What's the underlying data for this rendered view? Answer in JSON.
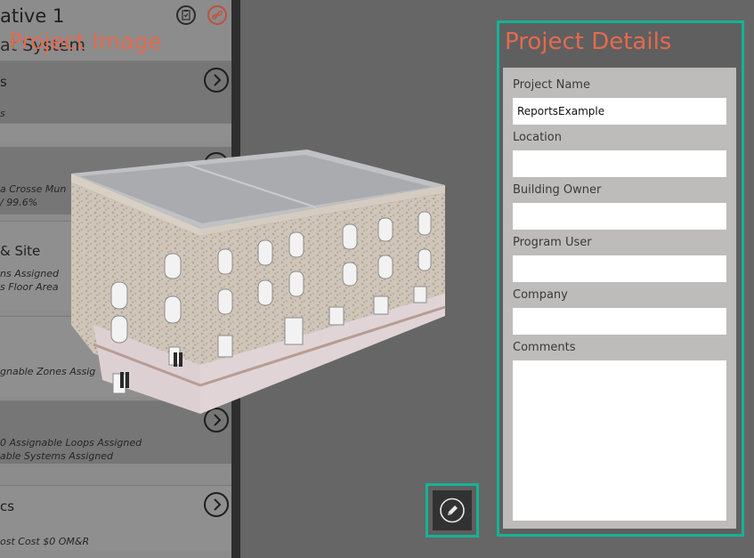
{
  "left_panel": {
    "title": "ative 1",
    "subtitle": "at System",
    "cards": [
      {
        "heading": "s",
        "details": [
          "s"
        ]
      },
      {
        "heading": "",
        "details": [
          "a Crosse Mun",
          "/ 99.6%"
        ]
      },
      {
        "heading": "& Site",
        "details": [
          "ns Assigned",
          "s Floor Area"
        ]
      },
      {
        "heading": "",
        "details": [
          "gnable Zones Assig"
        ]
      },
      {
        "heading": "",
        "details": [
          "0 Assignable Loops Assigned",
          "able Systems Assigned"
        ]
      },
      {
        "heading": "cs",
        "details": [
          "ost Cost $0 OM&R"
        ]
      }
    ]
  },
  "project_image": {
    "label": "Project Image"
  },
  "project_details": {
    "title": "Project Details",
    "fields": [
      {
        "label": "Project Name",
        "value": "ReportsExample"
      },
      {
        "label": "Location",
        "value": ""
      },
      {
        "label": "Building Owner",
        "value": ""
      },
      {
        "label": "Program User",
        "value": ""
      },
      {
        "label": "Company",
        "value": ""
      }
    ],
    "comments": {
      "label": "Comments",
      "value": ""
    }
  },
  "colors": {
    "accent": "#15b394",
    "title_orange": "#e46a4f",
    "background": "#666666"
  },
  "icons": {
    "edit": "pencil-icon",
    "clipboard": "clipboard-icon",
    "link": "link-icon",
    "go": "chevron-right-icon"
  }
}
